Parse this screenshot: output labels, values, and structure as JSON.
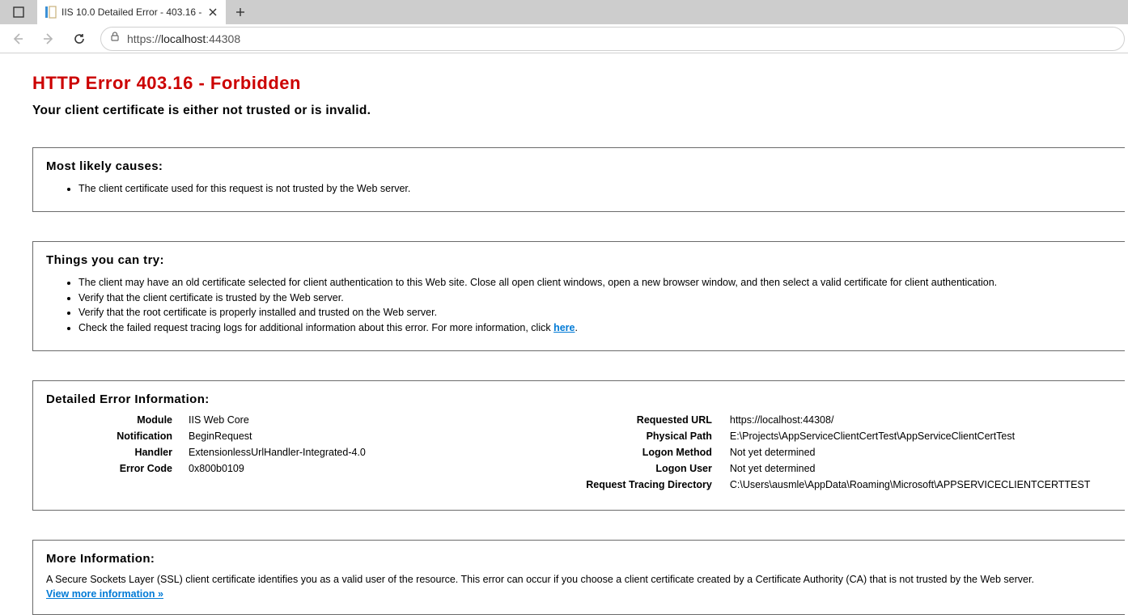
{
  "browser": {
    "tab_title": "IIS 10.0 Detailed Error - 403.16 -",
    "url_plain": "https://localhost:44308",
    "url_scheme": "https://",
    "url_host": "localhost",
    "url_port": ":44308"
  },
  "page": {
    "heading": "HTTP Error 403.16 - Forbidden",
    "subtitle": "Your client certificate is either not trusted or is invalid."
  },
  "section_causes": {
    "title": "Most likely causes:",
    "items": [
      "The client certificate used for this request is not trusted by the Web server."
    ]
  },
  "section_try": {
    "title": "Things you can try:",
    "items": [
      "The client may have an old certificate selected for client authentication to this Web site. Close all open client windows, open a new browser window, and then select a valid certificate for client authentication.",
      "Verify that the client certificate is trusted by the Web server.",
      "Verify that the root certificate is properly installed and trusted on the Web server."
    ],
    "tracing_prefix": "Check the failed request tracing logs for additional information about this error. For more information, click ",
    "tracing_link": "here",
    "tracing_suffix": "."
  },
  "section_detail": {
    "title": "Detailed Error Information:",
    "left": {
      "module_k": "Module",
      "module_v": "IIS Web Core",
      "notification_k": "Notification",
      "notification_v": "BeginRequest",
      "handler_k": "Handler",
      "handler_v": "ExtensionlessUrlHandler-Integrated-4.0",
      "errorcode_k": "Error Code",
      "errorcode_v": "0x800b0109"
    },
    "right": {
      "requrl_k": "Requested URL",
      "requrl_v": "https://localhost:44308/",
      "phys_k": "Physical Path",
      "phys_v": "E:\\Projects\\AppServiceClientCertTest\\AppServiceClientCertTest",
      "logonmethod_k": "Logon Method",
      "logonmethod_v": "Not yet determined",
      "logonuser_k": "Logon User",
      "logonuser_v": "Not yet determined",
      "tracedir_k": "Request Tracing Directory",
      "tracedir_v": "C:\\Users\\ausmle\\AppData\\Roaming\\Microsoft\\APPSERVICECLIENTCERTTEST"
    }
  },
  "section_more": {
    "title": "More Information:",
    "text": "A Secure Sockets Layer (SSL) client certificate identifies you as a valid user of the resource. This error can occur if you choose a client certificate created by a Certificate Authority (CA) that is not trusted by the Web server.",
    "link": "View more information »"
  }
}
